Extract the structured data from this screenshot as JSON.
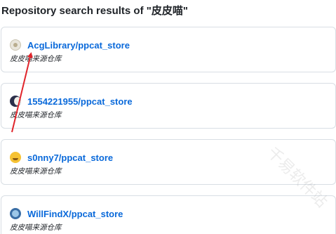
{
  "header": {
    "title": "Repository search results of \"皮皮喵\""
  },
  "results": [
    {
      "avatar_icon": "avatar-beige-icon",
      "name": "AcgLibrary/ppcat_store",
      "description": "皮皮喵来源仓库"
    },
    {
      "avatar_icon": "avatar-moon-icon",
      "name": "1554221955/ppcat_store",
      "description": "皮皮喵来源仓库"
    },
    {
      "avatar_icon": "avatar-smiley-icon",
      "name": "s0nny7/ppcat_store",
      "description": "皮皮喵来源仓库"
    },
    {
      "avatar_icon": "avatar-blue-icon",
      "name": "WillFindX/ppcat_store",
      "description": "皮皮喵来源仓库"
    }
  ],
  "annotation": {
    "arrow_color": "#e0242b"
  },
  "colors": {
    "link": "#0969da",
    "border": "#d8dee4",
    "text": "#1f2328"
  },
  "watermark": {
    "text": "千易软件站"
  }
}
